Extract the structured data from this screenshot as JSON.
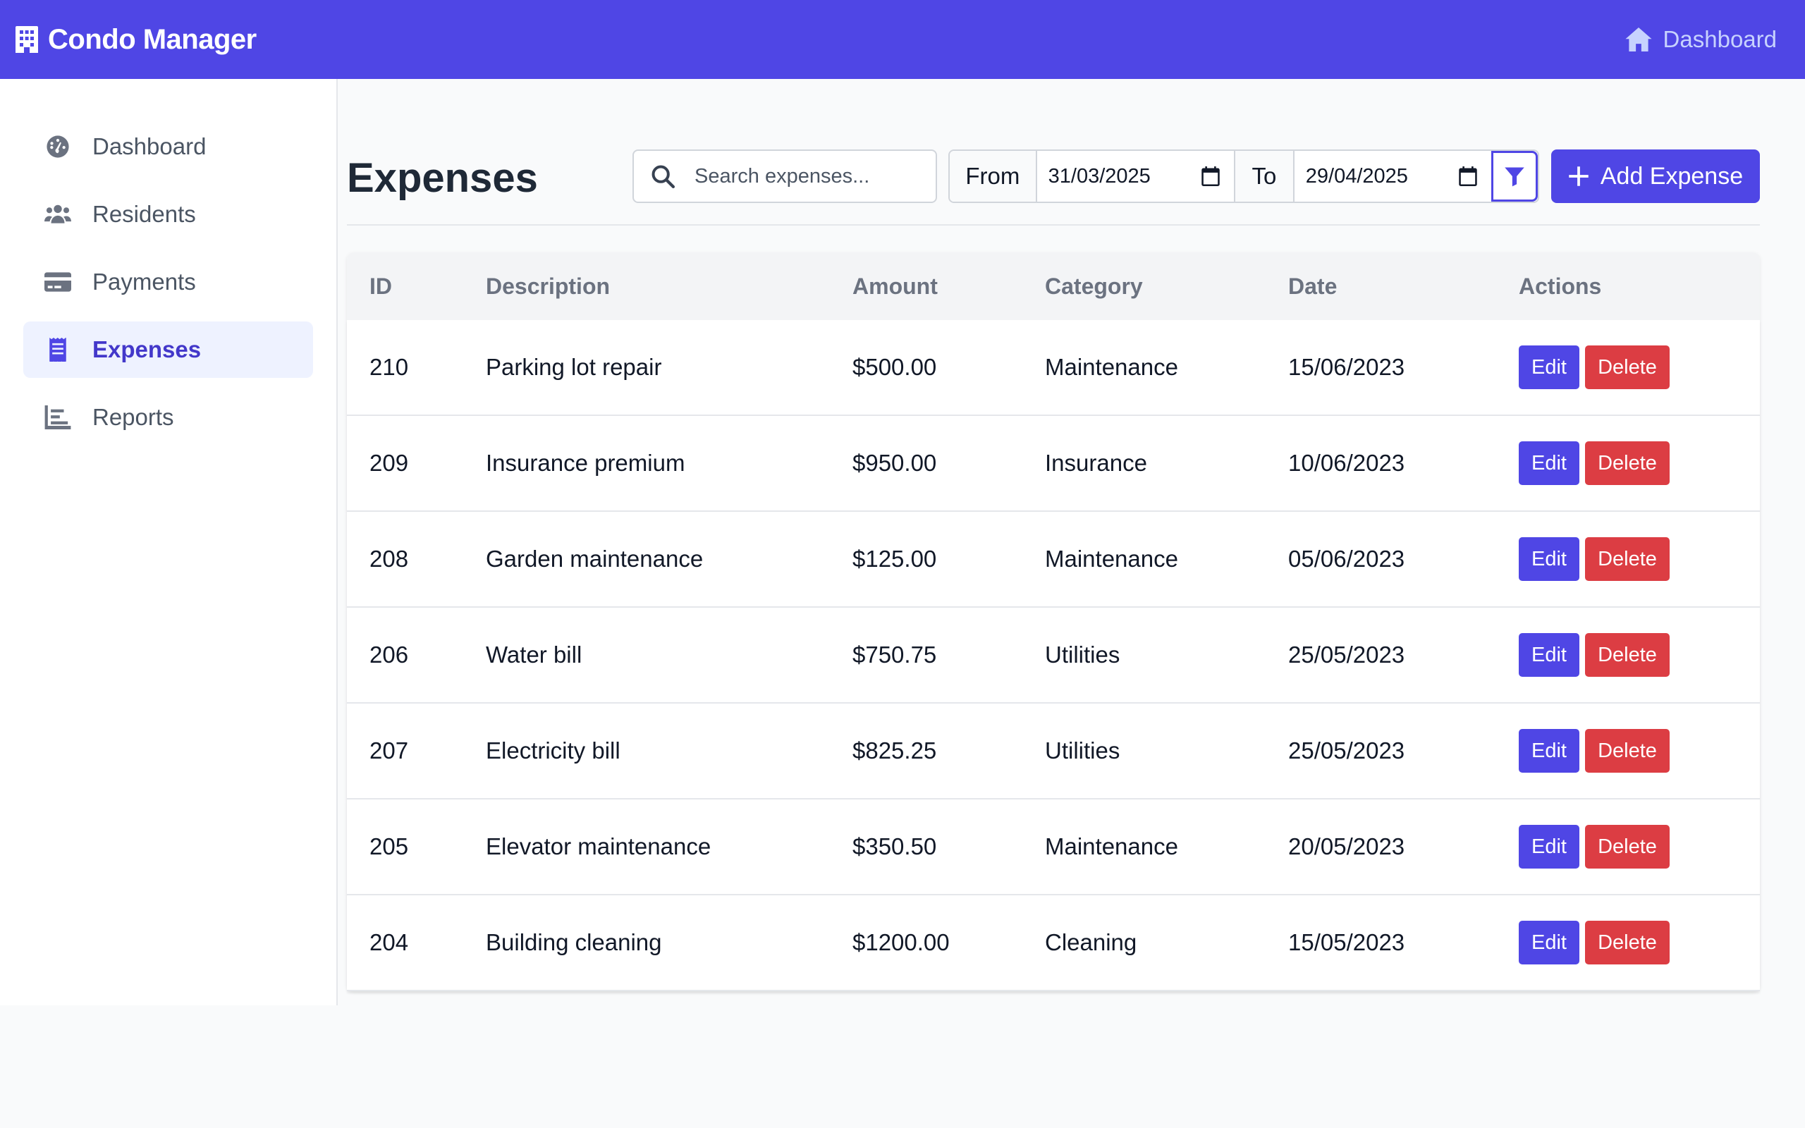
{
  "app": {
    "brand": "Condo Manager",
    "nav_dashboard": "Dashboard"
  },
  "sidebar": {
    "items": [
      {
        "label": "Dashboard",
        "icon": "gauge-icon"
      },
      {
        "label": "Residents",
        "icon": "users-icon"
      },
      {
        "label": "Payments",
        "icon": "credit-card-icon"
      },
      {
        "label": "Expenses",
        "icon": "receipt-icon",
        "active": true
      },
      {
        "label": "Reports",
        "icon": "bar-chart-icon"
      }
    ]
  },
  "main": {
    "title": "Expenses",
    "search_placeholder": "Search expenses...",
    "from_label": "From",
    "from_date": "31/03/2025",
    "to_label": "To",
    "to_date": "29/04/2025",
    "add_label": "Add Expense"
  },
  "table": {
    "headers": [
      "ID",
      "Description",
      "Amount",
      "Category",
      "Date",
      "Actions"
    ],
    "edit_label": "Edit",
    "delete_label": "Delete",
    "rows": [
      {
        "id": "210",
        "description": "Parking lot repair",
        "amount": "$500.00",
        "category": "Maintenance",
        "date": "15/06/2023"
      },
      {
        "id": "209",
        "description": "Insurance premium",
        "amount": "$950.00",
        "category": "Insurance",
        "date": "10/06/2023"
      },
      {
        "id": "208",
        "description": "Garden maintenance",
        "amount": "$125.00",
        "category": "Maintenance",
        "date": "05/06/2023"
      },
      {
        "id": "206",
        "description": "Water bill",
        "amount": "$750.75",
        "category": "Utilities",
        "date": "25/05/2023"
      },
      {
        "id": "207",
        "description": "Electricity bill",
        "amount": "$825.25",
        "category": "Utilities",
        "date": "25/05/2023"
      },
      {
        "id": "205",
        "description": "Elevator maintenance",
        "amount": "$350.50",
        "category": "Maintenance",
        "date": "20/05/2023"
      },
      {
        "id": "204",
        "description": "Building cleaning",
        "amount": "$1200.00",
        "category": "Cleaning",
        "date": "15/05/2023"
      }
    ]
  },
  "colors": {
    "primary": "#4f46e5",
    "danger": "#dc3d43",
    "sidebar_active_bg": "#eef2ff"
  }
}
